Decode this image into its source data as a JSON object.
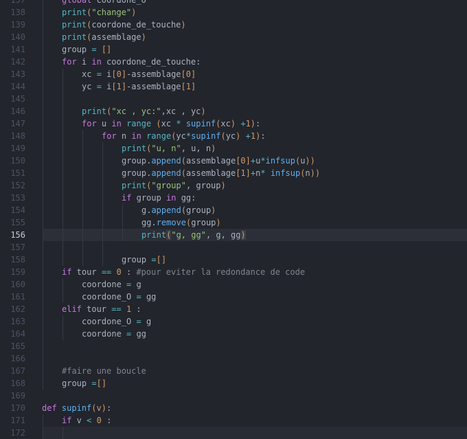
{
  "editor": {
    "theme_colors": {
      "background": "#22252c",
      "keyword": "#c678dd",
      "builtin": "#56b6c2",
      "method": "#61afef",
      "string": "#98c379",
      "number": "#d19a66",
      "comment": "#7f848e",
      "text": "#abb2bf"
    },
    "current_line": 156,
    "lines": [
      {
        "num": "137",
        "indent": 1,
        "tokens": [
          [
            "k",
            "global"
          ],
          [
            "t",
            " coordone_O"
          ]
        ]
      },
      {
        "num": "138",
        "indent": 1,
        "tokens": [
          [
            "f",
            "print"
          ],
          [
            "n",
            "("
          ],
          [
            "s",
            "\"change\""
          ],
          [
            "n",
            ")"
          ]
        ]
      },
      {
        "num": "139",
        "indent": 1,
        "tokens": [
          [
            "f",
            "print"
          ],
          [
            "n",
            "("
          ],
          [
            "t",
            "coordone_de_touche"
          ],
          [
            "n",
            ")"
          ]
        ]
      },
      {
        "num": "140",
        "indent": 1,
        "tokens": [
          [
            "f",
            "print"
          ],
          [
            "n",
            "("
          ],
          [
            "t",
            "assemblage"
          ],
          [
            "n",
            ")"
          ]
        ]
      },
      {
        "num": "141",
        "indent": 1,
        "tokens": [
          [
            "t",
            "group "
          ],
          [
            "o",
            "="
          ],
          [
            "t",
            " "
          ],
          [
            "n",
            "[]"
          ]
        ]
      },
      {
        "num": "142",
        "indent": 1,
        "tokens": [
          [
            "k",
            "for"
          ],
          [
            "t",
            " i "
          ],
          [
            "k",
            "in"
          ],
          [
            "t",
            " coordone_de_touche:"
          ]
        ]
      },
      {
        "num": "143",
        "indent": 2,
        "tokens": [
          [
            "t",
            "xc "
          ],
          [
            "o",
            "="
          ],
          [
            "t",
            " i"
          ],
          [
            "n",
            "[0]"
          ],
          [
            "t",
            "-assemblage"
          ],
          [
            "n",
            "[0]"
          ]
        ]
      },
      {
        "num": "144",
        "indent": 2,
        "tokens": [
          [
            "t",
            "yc "
          ],
          [
            "o",
            "="
          ],
          [
            "t",
            " i"
          ],
          [
            "n",
            "[1]"
          ],
          [
            "t",
            "-assemblage"
          ],
          [
            "n",
            "[1]"
          ]
        ]
      },
      {
        "num": "145",
        "indent": 2,
        "tokens": []
      },
      {
        "num": "146",
        "indent": 2,
        "tokens": [
          [
            "f",
            "print"
          ],
          [
            "n",
            "("
          ],
          [
            "s",
            "\"xc , yc:\""
          ],
          [
            "t",
            ",xc , yc"
          ],
          [
            "n",
            ")"
          ]
        ]
      },
      {
        "num": "147",
        "indent": 2,
        "tokens": [
          [
            "k",
            "for"
          ],
          [
            "t",
            " u "
          ],
          [
            "k",
            "in"
          ],
          [
            "t",
            " "
          ],
          [
            "f",
            "range"
          ],
          [
            "t",
            " "
          ],
          [
            "n",
            "("
          ],
          [
            "t",
            "xc "
          ],
          [
            "o",
            "*"
          ],
          [
            "t",
            " "
          ],
          [
            "m",
            "supinf"
          ],
          [
            "n",
            "("
          ],
          [
            "t",
            "xc"
          ],
          [
            "n",
            ")"
          ],
          [
            "t",
            " "
          ],
          [
            "o",
            "+"
          ],
          [
            "n",
            "1"
          ],
          [
            "n",
            ")"
          ],
          [
            "t",
            ":"
          ]
        ]
      },
      {
        "num": "148",
        "indent": 3,
        "tokens": [
          [
            "k",
            "for"
          ],
          [
            "t",
            " n "
          ],
          [
            "k",
            "in"
          ],
          [
            "t",
            " "
          ],
          [
            "f",
            "range"
          ],
          [
            "n",
            "("
          ],
          [
            "t",
            "yc"
          ],
          [
            "o",
            "*"
          ],
          [
            "m",
            "supinf"
          ],
          [
            "n",
            "("
          ],
          [
            "t",
            "yc"
          ],
          [
            "n",
            ")"
          ],
          [
            "t",
            " "
          ],
          [
            "o",
            "+"
          ],
          [
            "n",
            "1"
          ],
          [
            "n",
            ")"
          ],
          [
            "t",
            ":"
          ]
        ]
      },
      {
        "num": "149",
        "indent": 4,
        "tokens": [
          [
            "f",
            "print"
          ],
          [
            "n",
            "("
          ],
          [
            "s",
            "\"u, n\""
          ],
          [
            "t",
            ", u, n"
          ],
          [
            "n",
            ")"
          ]
        ]
      },
      {
        "num": "150",
        "indent": 4,
        "tokens": [
          [
            "t",
            "group."
          ],
          [
            "m",
            "append"
          ],
          [
            "n",
            "("
          ],
          [
            "t",
            "assemblage"
          ],
          [
            "n",
            "[0]"
          ],
          [
            "o",
            "+"
          ],
          [
            "t",
            "u"
          ],
          [
            "o",
            "*"
          ],
          [
            "m",
            "infsup"
          ],
          [
            "n",
            "("
          ],
          [
            "t",
            "u"
          ],
          [
            "n",
            "))"
          ]
        ]
      },
      {
        "num": "151",
        "indent": 4,
        "tokens": [
          [
            "t",
            "group."
          ],
          [
            "m",
            "append"
          ],
          [
            "n",
            "("
          ],
          [
            "t",
            "assemblage"
          ],
          [
            "n",
            "[1]"
          ],
          [
            "o",
            "+"
          ],
          [
            "t",
            "n"
          ],
          [
            "o",
            "*"
          ],
          [
            "t",
            " "
          ],
          [
            "m",
            "infsup"
          ],
          [
            "n",
            "("
          ],
          [
            "t",
            "n"
          ],
          [
            "n",
            "))"
          ]
        ]
      },
      {
        "num": "152",
        "indent": 4,
        "tokens": [
          [
            "f",
            "print"
          ],
          [
            "n",
            "("
          ],
          [
            "s",
            "\"group\""
          ],
          [
            "t",
            ", group"
          ],
          [
            "n",
            ")"
          ]
        ]
      },
      {
        "num": "153",
        "indent": 4,
        "tokens": [
          [
            "k",
            "if"
          ],
          [
            "t",
            " group "
          ],
          [
            "k",
            "in"
          ],
          [
            "t",
            " gg:"
          ]
        ]
      },
      {
        "num": "154",
        "indent": 5,
        "tokens": [
          [
            "t",
            "g."
          ],
          [
            "m",
            "append"
          ],
          [
            "n",
            "("
          ],
          [
            "t",
            "group"
          ],
          [
            "n",
            ")"
          ]
        ]
      },
      {
        "num": "155",
        "indent": 5,
        "tokens": [
          [
            "t",
            "gg."
          ],
          [
            "m",
            "remove"
          ],
          [
            "n",
            "("
          ],
          [
            "t",
            "group"
          ],
          [
            "n",
            ")"
          ]
        ]
      },
      {
        "num": "156",
        "indent": 5,
        "tokens": [
          [
            "f",
            "print"
          ],
          [
            "b",
            "("
          ],
          [
            "s",
            "\"g, gg\""
          ],
          [
            "t",
            ", g, gg"
          ],
          [
            "b",
            ")"
          ]
        ]
      },
      {
        "num": "157",
        "indent": 4,
        "tokens": []
      },
      {
        "num": "158",
        "indent": 4,
        "tokens": [
          [
            "t",
            "group "
          ],
          [
            "o",
            "="
          ],
          [
            "n",
            "[]"
          ]
        ]
      },
      {
        "num": "159",
        "indent": 1,
        "tokens": [
          [
            "k",
            "if"
          ],
          [
            "t",
            " tour "
          ],
          [
            "o",
            "=="
          ],
          [
            "t",
            " "
          ],
          [
            "n",
            "0"
          ],
          [
            "t",
            " : "
          ],
          [
            "c",
            "#pour eviter la redondance de code"
          ]
        ]
      },
      {
        "num": "160",
        "indent": 2,
        "tokens": [
          [
            "t",
            "coordone "
          ],
          [
            "o",
            "="
          ],
          [
            "t",
            " g"
          ]
        ]
      },
      {
        "num": "161",
        "indent": 2,
        "tokens": [
          [
            "t",
            "coordone_O "
          ],
          [
            "o",
            "="
          ],
          [
            "t",
            " gg"
          ]
        ]
      },
      {
        "num": "162",
        "indent": 1,
        "tokens": [
          [
            "k",
            "elif"
          ],
          [
            "t",
            " tour "
          ],
          [
            "o",
            "=="
          ],
          [
            "t",
            " "
          ],
          [
            "n",
            "1"
          ],
          [
            "t",
            " :"
          ]
        ]
      },
      {
        "num": "163",
        "indent": 2,
        "tokens": [
          [
            "t",
            "coordone_O "
          ],
          [
            "o",
            "="
          ],
          [
            "t",
            " g"
          ]
        ]
      },
      {
        "num": "164",
        "indent": 2,
        "tokens": [
          [
            "t",
            "coordone "
          ],
          [
            "o",
            "="
          ],
          [
            "t",
            " gg"
          ]
        ]
      },
      {
        "num": "165",
        "indent": 1,
        "tokens": []
      },
      {
        "num": "166",
        "indent": 1,
        "tokens": []
      },
      {
        "num": "167",
        "indent": 1,
        "tokens": [
          [
            "c",
            "#faire une boucle"
          ]
        ]
      },
      {
        "num": "168",
        "indent": 1,
        "tokens": [
          [
            "t",
            "group "
          ],
          [
            "o",
            "="
          ],
          [
            "n",
            "[]"
          ]
        ]
      },
      {
        "num": "169",
        "indent": 0,
        "tokens": []
      },
      {
        "num": "170",
        "indent": 0,
        "tokens": [
          [
            "k",
            "def"
          ],
          [
            "t",
            " "
          ],
          [
            "m",
            "supinf"
          ],
          [
            "n",
            "("
          ],
          [
            "n",
            "v"
          ],
          [
            "n",
            ")"
          ],
          [
            "t",
            ":"
          ]
        ]
      },
      {
        "num": "171",
        "indent": 1,
        "tokens": [
          [
            "k",
            "if"
          ],
          [
            "t",
            " v "
          ],
          [
            "o",
            "<"
          ],
          [
            "t",
            " "
          ],
          [
            "n",
            "0"
          ],
          [
            "t",
            " :"
          ]
        ]
      },
      {
        "num": "172",
        "indent": 2,
        "tokens": []
      }
    ]
  }
}
